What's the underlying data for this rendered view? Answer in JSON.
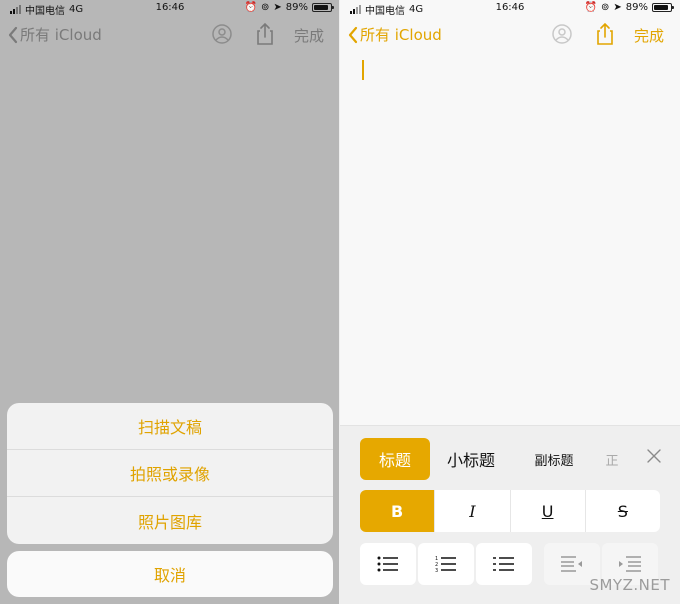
{
  "status": {
    "carrier": "中国电信",
    "network": "4G",
    "time": "16:46",
    "battery_pct": "89%",
    "battery_level": 0.89
  },
  "nav": {
    "back_label": "所有 iCloud",
    "done_label": "完成"
  },
  "action_sheet": {
    "items": [
      "扫描文稿",
      "拍照或录像",
      "照片图库"
    ],
    "cancel_label": "取消"
  },
  "format_panel": {
    "styles": {
      "title": "标题",
      "subtitle": "小标题",
      "subheading": "副标题",
      "body": "正"
    },
    "format_buttons": {
      "bold": "B",
      "italic": "I",
      "underline": "U",
      "strikethrough": "S"
    }
  },
  "watermark": "SMYZ.NET",
  "colors": {
    "accent": "#e2a500",
    "dimmed_bg": "#b7b7b7",
    "note_bg": "#f8f8f8"
  }
}
